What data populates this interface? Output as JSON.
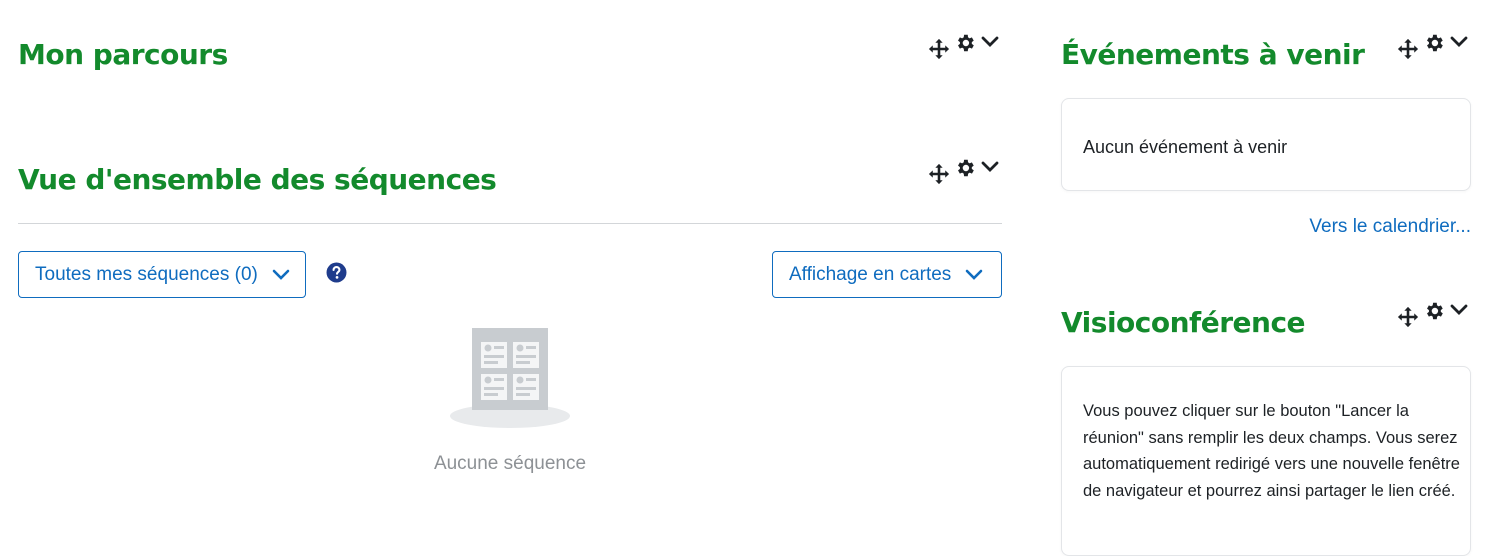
{
  "main": {
    "my_path": {
      "title": "Mon parcours"
    },
    "course_overview": {
      "title": "Vue d'ensemble des séquences",
      "filter_dropdown": {
        "label": "Toutes mes séquences (0)",
        "icon": "chevron-down-icon"
      },
      "help_icon": "question-circle-icon",
      "view_dropdown": {
        "label": "Affichage en cartes",
        "icon": "chevron-down-icon"
      },
      "empty_state": {
        "illustration": "course-cards-placeholder",
        "text": "Aucune séquence"
      }
    },
    "block_controls_icons": [
      "move-icon",
      "gear-icon",
      "chevron-down-icon"
    ]
  },
  "sidebar": {
    "upcoming_events": {
      "title": "Événements à venir",
      "empty_text": "Aucun événement à venir",
      "calendar_link": "Vers le calendrier..."
    },
    "videoconference": {
      "title": "Visioconférence",
      "description": "Vous pouvez cliquer sur le bouton \"Lancer la réunion\" sans remplir les deux champs. Vous serez automatiquement redirigé vers une nouvelle fenêtre de navigateur et pourrez ainsi partager le lien créé."
    }
  },
  "colors": {
    "title_green": "#138a2c",
    "link_blue": "#0f6cbf",
    "help_icon_navy": "#1f3c8c",
    "muted_text": "#8d9195",
    "divider": "#d3d6d9"
  }
}
